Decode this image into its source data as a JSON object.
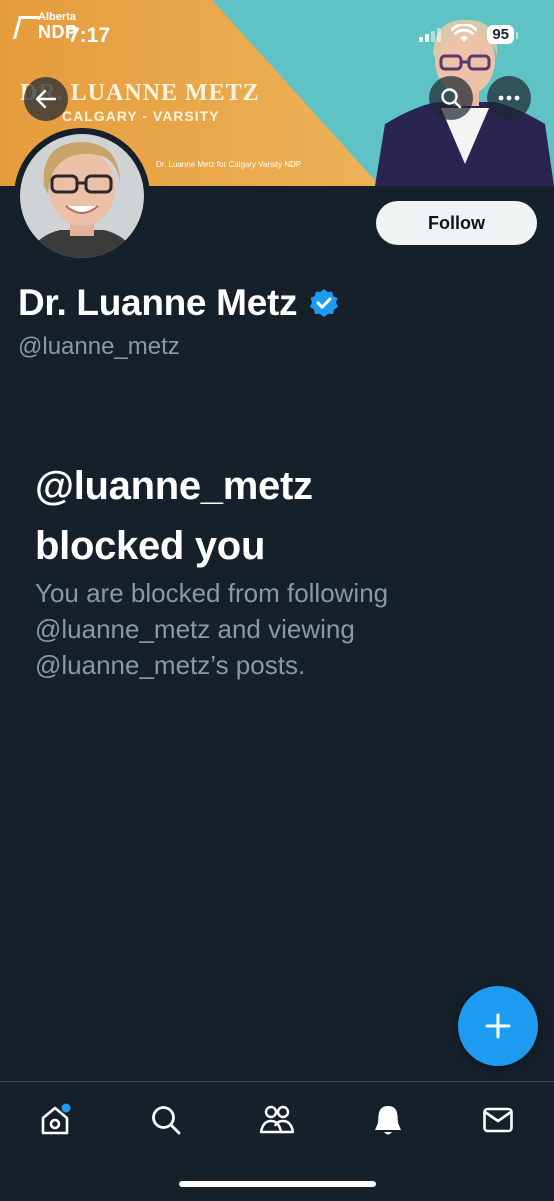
{
  "status_bar": {
    "time": "7:17",
    "battery": "95"
  },
  "banner": {
    "logo_small": "Alberta",
    "logo_big": "NDP",
    "title": "DR. LUANNE METZ",
    "subtitle": "CALGARY - VARSITY",
    "caption": "Dr. Luanne Metz for Calgary Varsity NDP"
  },
  "profile": {
    "display_name": "Dr. Luanne Metz",
    "handle": "@luanne_metz",
    "verified": true,
    "follow_label": "Follow"
  },
  "blocked": {
    "title_line1": "@luanne_metz",
    "title_line2": "blocked you",
    "desc_line1": "You are blocked from following",
    "desc_line2": "@luanne_metz and viewing",
    "desc_line3": "@luanne_metz’s posts."
  },
  "bottom_nav": [
    "home-icon",
    "search-icon",
    "communities-icon",
    "notifications-icon",
    "messages-icon"
  ],
  "colors": {
    "background": "#15202b",
    "accent": "#1d9bf0",
    "verified": "#1d9bf0",
    "muted_text": "#8b98a5",
    "banner_orange": "#e8a64a",
    "banner_teal": "#5fc3c6"
  }
}
